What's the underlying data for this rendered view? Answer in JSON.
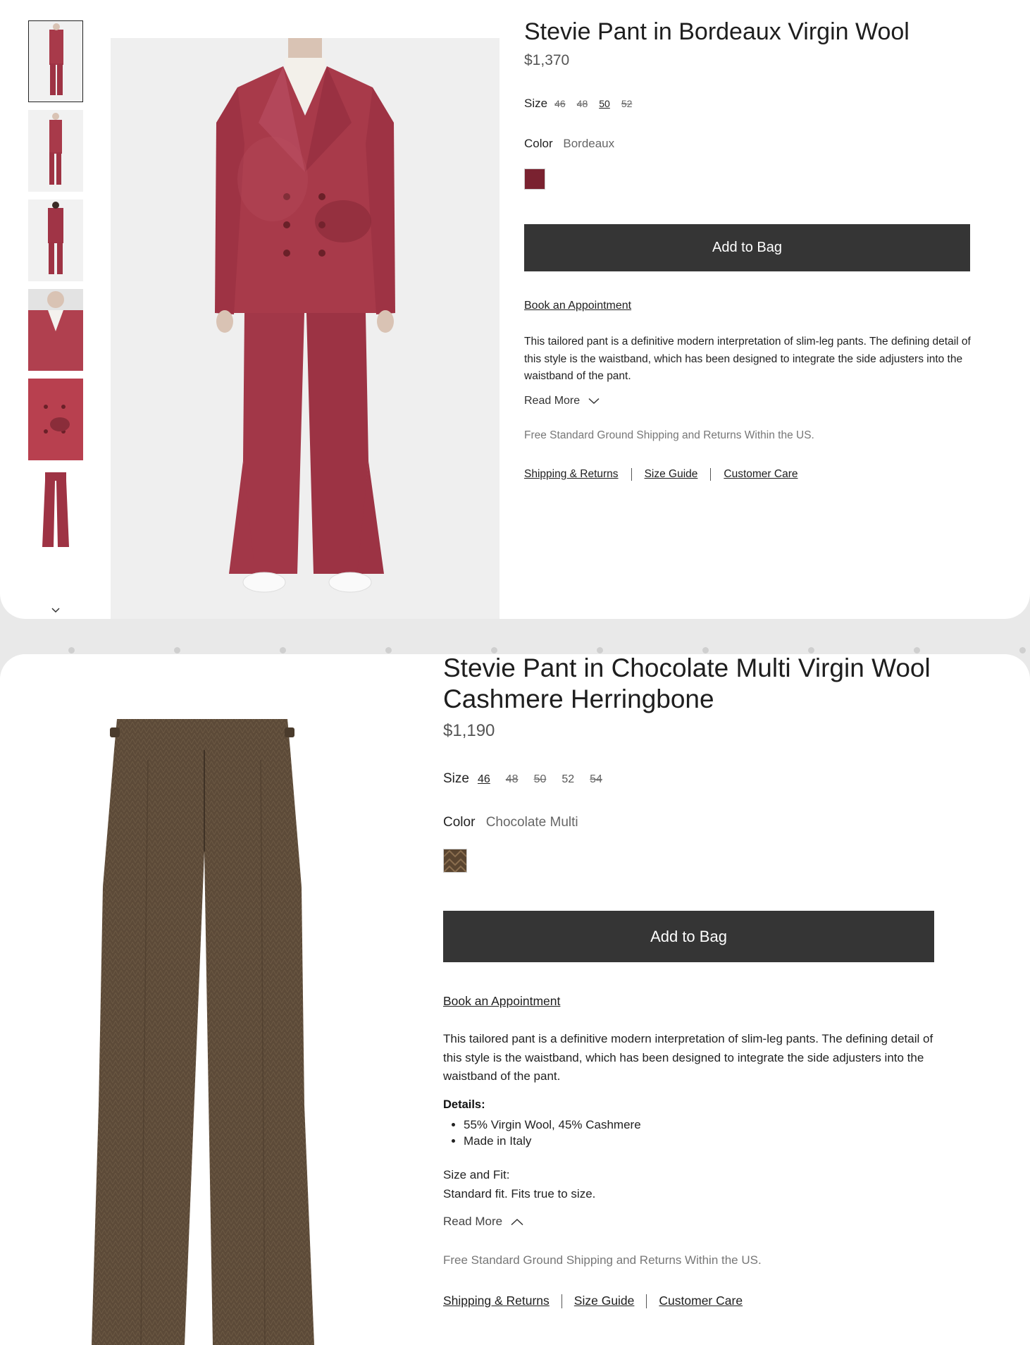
{
  "product1": {
    "title": "Stevie Pant in Bordeaux Virgin Wool",
    "price": "$1,370",
    "size_label": "Size",
    "sizes": [
      "46",
      "48",
      "50",
      "52"
    ],
    "color_label": "Color",
    "color_value": "Bordeaux",
    "swatch_color": "#7a2230",
    "add_to_bag": "Add to Bag",
    "book_appointment": "Book an Appointment",
    "description": "This tailored pant is a definitive modern interpretation of slim-leg pants. The defining detail of this style is the waistband, which has been designed to integrate the side adjusters into the waistband of the pant.",
    "read_more": "Read More",
    "shipping_note": "Free Standard Ground Shipping and Returns Within the US.",
    "links": [
      "Shipping & Returns",
      "Size Guide",
      "Customer Care"
    ]
  },
  "product2": {
    "title_line1": "Stevie Pant in Chocolate Multi Virgin Wool",
    "title_line2": "Cashmere Herringbone",
    "price": "$1,190",
    "size_label": "Size",
    "sizes": [
      "46",
      "48",
      "50",
      "52",
      "54"
    ],
    "color_label": "Color",
    "color_value": "Chocolate Multi",
    "swatch_color": "#5a4530",
    "add_to_bag": "Add to Bag",
    "book_appointment": "Book an Appointment",
    "description": "This tailored pant is a definitive modern interpretation of slim-leg pants. The defining detail of this style is the waistband, which has been designed to integrate the side adjusters into the waistband of the pant.",
    "details_heading": "Details:",
    "details": [
      "55% Virgin Wool, 45% Cashmere",
      "Made in Italy"
    ],
    "fit_heading": "Size and Fit:",
    "fit_text": "Standard fit. Fits true to size.",
    "read_more": "Read More",
    "shipping_note": "Free Standard Ground Shipping and Returns Within the US.",
    "links": [
      "Shipping & Returns",
      "Size Guide",
      "Customer Care"
    ]
  },
  "colors": {
    "button_bg": "#353535",
    "suit_red": "#a83a4a",
    "pant_brown": "#5c4a38"
  }
}
